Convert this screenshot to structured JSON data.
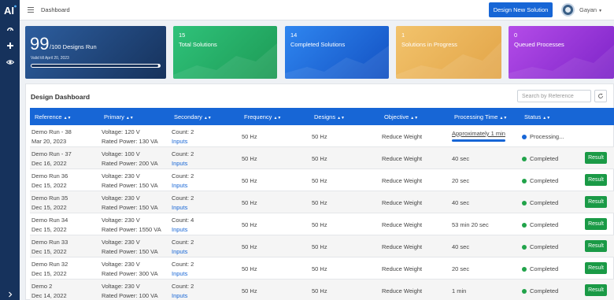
{
  "sidebar": {
    "logo_text": "AI",
    "items": [
      {
        "icon": "dashboard-icon"
      },
      {
        "icon": "plus-icon"
      },
      {
        "icon": "eye-icon"
      },
      {
        "icon": "chevron-right-icon"
      }
    ]
  },
  "topbar": {
    "breadcrumb": "Dashboard",
    "new_button": "Design New Solution",
    "user_name": "Gayan"
  },
  "cards": {
    "runs": {
      "count": "99",
      "total": "/100 Designs Run",
      "valid": "Valid till April 20, 2023",
      "progress_fraction": 0.99
    },
    "total": {
      "count": "15",
      "label": "Total Solutions"
    },
    "completed": {
      "count": "14",
      "label": "Completed Solutions"
    },
    "in_progress": {
      "count": "1",
      "label": "Solutions in Progress"
    },
    "queued": {
      "count": "0",
      "label": "Queued Processes"
    }
  },
  "dashboard": {
    "title": "Design Dashboard",
    "search_placeholder": "Search by Reference",
    "columns": [
      "Reference",
      "Primary",
      "Secondary",
      "Frequency",
      "Designs",
      "Objective",
      "Processing Time",
      "Status"
    ],
    "result_label": "Result",
    "rows": [
      {
        "ref": "Demo Run - 38",
        "date": "Mar 20, 2023",
        "voltage": "Voltage: 120 V",
        "power": "Rated Power: 130 VA",
        "count": "Count: 2",
        "inputs": "Inputs",
        "frequency": "50 Hz",
        "designs": "50 Hz",
        "objective": "Reduce Weight",
        "ptime": "Approximately 1 min",
        "status": "Processing...",
        "state": "processing"
      },
      {
        "ref": "Demo Run - 37",
        "date": "Dec 16, 2022",
        "voltage": "Voltage: 100 V",
        "power": "Rated Power: 200 VA",
        "count": "Count: 2",
        "inputs": "Inputs",
        "frequency": "50 Hz",
        "designs": "50 Hz",
        "objective": "Reduce Weight",
        "ptime": "40 sec",
        "status": "Completed",
        "state": "completed"
      },
      {
        "ref": "Demo Run 36",
        "date": "Dec 15, 2022",
        "voltage": "Voltage: 230 V",
        "power": "Rated Power: 150 VA",
        "count": "Count: 2",
        "inputs": "Inputs",
        "frequency": "50 Hz",
        "designs": "50 Hz",
        "objective": "Reduce Weight",
        "ptime": "20 sec",
        "status": "Completed",
        "state": "completed"
      },
      {
        "ref": "Demo Run 35",
        "date": "Dec 15, 2022",
        "voltage": "Voltage: 230 V",
        "power": "Rated Power: 150 VA",
        "count": "Count: 2",
        "inputs": "Inputs",
        "frequency": "50 Hz",
        "designs": "50 Hz",
        "objective": "Reduce Weight",
        "ptime": "40 sec",
        "status": "Completed",
        "state": "completed"
      },
      {
        "ref": "Demo Run 34",
        "date": "Dec 15, 2022",
        "voltage": "Voltage: 230 V",
        "power": "Rated Power: 1550 VA",
        "count": "Count: 4",
        "inputs": "Inputs",
        "frequency": "50 Hz",
        "designs": "50 Hz",
        "objective": "Reduce Weight",
        "ptime": "53 min 20 sec",
        "status": "Completed",
        "state": "completed"
      },
      {
        "ref": "Demo Run 33",
        "date": "Dec 15, 2022",
        "voltage": "Voltage: 230 V",
        "power": "Rated Power: 150 VA",
        "count": "Count: 2",
        "inputs": "Inputs",
        "frequency": "50 Hz",
        "designs": "50 Hz",
        "objective": "Reduce Weight",
        "ptime": "40 sec",
        "status": "Completed",
        "state": "completed"
      },
      {
        "ref": "Demo Run 32",
        "date": "Dec 15, 2022",
        "voltage": "Voltage: 230 V",
        "power": "Rated Power: 300 VA",
        "count": "Count: 2",
        "inputs": "Inputs",
        "frequency": "50 Hz",
        "designs": "50 Hz",
        "objective": "Reduce Weight",
        "ptime": "20 sec",
        "status": "Completed",
        "state": "completed"
      },
      {
        "ref": "Demo 2",
        "date": "Dec 14, 2022",
        "voltage": "Voltage: 230 V",
        "power": "Rated Power: 100 VA",
        "count": "Count: 2",
        "inputs": "Inputs",
        "frequency": "50 Hz",
        "designs": "50 Hz",
        "objective": "Reduce Weight",
        "ptime": "1 min",
        "status": "Completed",
        "state": "completed"
      }
    ]
  },
  "colors": {
    "sidebar": "#16325c",
    "primary": "#1766d6",
    "success": "#1a9a46",
    "card_total": "#2fc27a",
    "card_completed": "#2f86f0",
    "card_in_progress": "#f2c36c",
    "card_queued": "#b44ce8"
  }
}
